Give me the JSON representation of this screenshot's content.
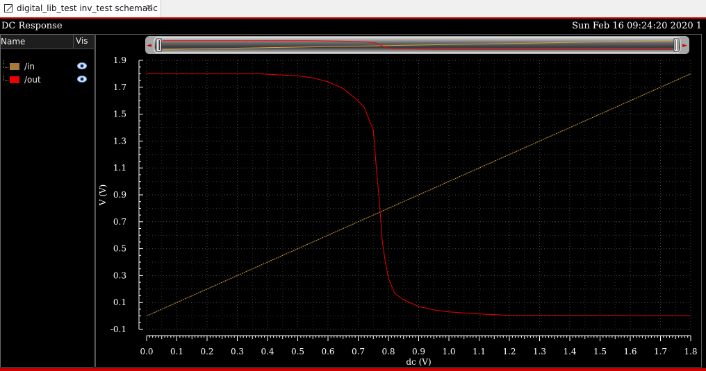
{
  "tab": {
    "title": "digital_lib_test inv_test schematic",
    "close_glyph": "✕"
  },
  "header": {
    "title": "DC Response",
    "timestamp": "Sun Feb 16 09:24:20 2020  1"
  },
  "legend": {
    "col_name": "Name",
    "col_vis": "Vis",
    "items": [
      {
        "label": "/in",
        "color": "#a87a3a",
        "icon": "eye-icon"
      },
      {
        "label": "/out",
        "color": "#ee0000",
        "icon": "eye-icon"
      }
    ]
  },
  "scroller": {
    "left_glyph": "◄",
    "right_glyph": "►"
  },
  "chart_data": {
    "type": "line",
    "xlabel": "dc (V)",
    "ylabel": "V (V)",
    "xlim": [
      0.0,
      1.8
    ],
    "ylim": [
      -0.1,
      1.9
    ],
    "xticks": [
      "0.0",
      "0.1",
      "0.2",
      "0.3",
      "0.4",
      "0.5",
      "0.6",
      "0.7",
      "0.8",
      "0.9",
      "1.0",
      "1.1",
      "1.2",
      "1.3",
      "1.4",
      "1.5",
      "1.6",
      "1.7",
      "1.8"
    ],
    "yticks": [
      "1.9",
      "1.7",
      "1.5",
      "1.3",
      "1.1",
      "0.9",
      "0.7",
      "0.5",
      "0.3",
      "0.1",
      "-0.1"
    ],
    "grid": true,
    "series": [
      {
        "name": "/in",
        "color": "#d8a040",
        "x": [
          0.0,
          1.8
        ],
        "y": [
          0.0,
          1.8
        ]
      },
      {
        "name": "/out",
        "color": "#ee0000",
        "x": [
          0.0,
          0.2,
          0.37,
          0.45,
          0.5,
          0.55,
          0.6,
          0.65,
          0.7,
          0.72,
          0.75,
          0.76,
          0.77,
          0.78,
          0.79,
          0.8,
          0.82,
          0.85,
          0.9,
          0.95,
          1.0,
          1.1,
          1.2,
          1.4,
          1.6,
          1.8
        ],
        "y": [
          1.8,
          1.8,
          1.8,
          1.79,
          1.785,
          1.77,
          1.74,
          1.69,
          1.6,
          1.55,
          1.38,
          1.1,
          0.85,
          0.55,
          0.4,
          0.28,
          0.17,
          0.12,
          0.07,
          0.045,
          0.03,
          0.015,
          0.005,
          0.003,
          0.002,
          0.002
        ]
      }
    ]
  }
}
